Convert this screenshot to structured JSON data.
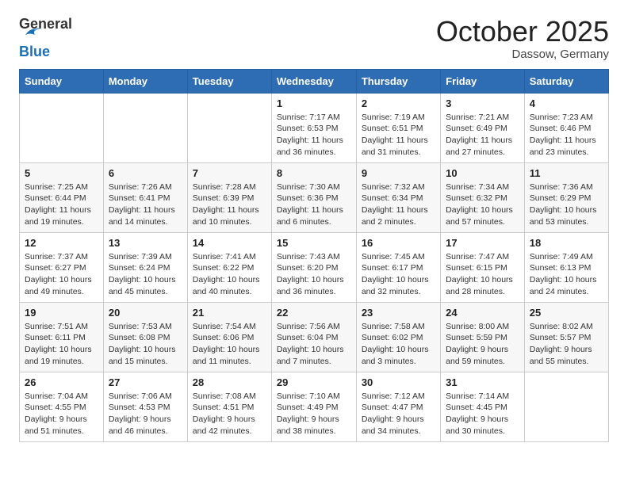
{
  "logo": {
    "general": "General",
    "blue": "Blue"
  },
  "title": {
    "month_year": "October 2025",
    "location": "Dassow, Germany"
  },
  "headers": [
    "Sunday",
    "Monday",
    "Tuesday",
    "Wednesday",
    "Thursday",
    "Friday",
    "Saturday"
  ],
  "weeks": [
    [
      {
        "day": "",
        "info": ""
      },
      {
        "day": "",
        "info": ""
      },
      {
        "day": "",
        "info": ""
      },
      {
        "day": "1",
        "info": "Sunrise: 7:17 AM\nSunset: 6:53 PM\nDaylight: 11 hours and 36 minutes."
      },
      {
        "day": "2",
        "info": "Sunrise: 7:19 AM\nSunset: 6:51 PM\nDaylight: 11 hours and 31 minutes."
      },
      {
        "day": "3",
        "info": "Sunrise: 7:21 AM\nSunset: 6:49 PM\nDaylight: 11 hours and 27 minutes."
      },
      {
        "day": "4",
        "info": "Sunrise: 7:23 AM\nSunset: 6:46 PM\nDaylight: 11 hours and 23 minutes."
      }
    ],
    [
      {
        "day": "5",
        "info": "Sunrise: 7:25 AM\nSunset: 6:44 PM\nDaylight: 11 hours and 19 minutes."
      },
      {
        "day": "6",
        "info": "Sunrise: 7:26 AM\nSunset: 6:41 PM\nDaylight: 11 hours and 14 minutes."
      },
      {
        "day": "7",
        "info": "Sunrise: 7:28 AM\nSunset: 6:39 PM\nDaylight: 11 hours and 10 minutes."
      },
      {
        "day": "8",
        "info": "Sunrise: 7:30 AM\nSunset: 6:36 PM\nDaylight: 11 hours and 6 minutes."
      },
      {
        "day": "9",
        "info": "Sunrise: 7:32 AM\nSunset: 6:34 PM\nDaylight: 11 hours and 2 minutes."
      },
      {
        "day": "10",
        "info": "Sunrise: 7:34 AM\nSunset: 6:32 PM\nDaylight: 10 hours and 57 minutes."
      },
      {
        "day": "11",
        "info": "Sunrise: 7:36 AM\nSunset: 6:29 PM\nDaylight: 10 hours and 53 minutes."
      }
    ],
    [
      {
        "day": "12",
        "info": "Sunrise: 7:37 AM\nSunset: 6:27 PM\nDaylight: 10 hours and 49 minutes."
      },
      {
        "day": "13",
        "info": "Sunrise: 7:39 AM\nSunset: 6:24 PM\nDaylight: 10 hours and 45 minutes."
      },
      {
        "day": "14",
        "info": "Sunrise: 7:41 AM\nSunset: 6:22 PM\nDaylight: 10 hours and 40 minutes."
      },
      {
        "day": "15",
        "info": "Sunrise: 7:43 AM\nSunset: 6:20 PM\nDaylight: 10 hours and 36 minutes."
      },
      {
        "day": "16",
        "info": "Sunrise: 7:45 AM\nSunset: 6:17 PM\nDaylight: 10 hours and 32 minutes."
      },
      {
        "day": "17",
        "info": "Sunrise: 7:47 AM\nSunset: 6:15 PM\nDaylight: 10 hours and 28 minutes."
      },
      {
        "day": "18",
        "info": "Sunrise: 7:49 AM\nSunset: 6:13 PM\nDaylight: 10 hours and 24 minutes."
      }
    ],
    [
      {
        "day": "19",
        "info": "Sunrise: 7:51 AM\nSunset: 6:11 PM\nDaylight: 10 hours and 19 minutes."
      },
      {
        "day": "20",
        "info": "Sunrise: 7:53 AM\nSunset: 6:08 PM\nDaylight: 10 hours and 15 minutes."
      },
      {
        "day": "21",
        "info": "Sunrise: 7:54 AM\nSunset: 6:06 PM\nDaylight: 10 hours and 11 minutes."
      },
      {
        "day": "22",
        "info": "Sunrise: 7:56 AM\nSunset: 6:04 PM\nDaylight: 10 hours and 7 minutes."
      },
      {
        "day": "23",
        "info": "Sunrise: 7:58 AM\nSunset: 6:02 PM\nDaylight: 10 hours and 3 minutes."
      },
      {
        "day": "24",
        "info": "Sunrise: 8:00 AM\nSunset: 5:59 PM\nDaylight: 9 hours and 59 minutes."
      },
      {
        "day": "25",
        "info": "Sunrise: 8:02 AM\nSunset: 5:57 PM\nDaylight: 9 hours and 55 minutes."
      }
    ],
    [
      {
        "day": "26",
        "info": "Sunrise: 7:04 AM\nSunset: 4:55 PM\nDaylight: 9 hours and 51 minutes."
      },
      {
        "day": "27",
        "info": "Sunrise: 7:06 AM\nSunset: 4:53 PM\nDaylight: 9 hours and 46 minutes."
      },
      {
        "day": "28",
        "info": "Sunrise: 7:08 AM\nSunset: 4:51 PM\nDaylight: 9 hours and 42 minutes."
      },
      {
        "day": "29",
        "info": "Sunrise: 7:10 AM\nSunset: 4:49 PM\nDaylight: 9 hours and 38 minutes."
      },
      {
        "day": "30",
        "info": "Sunrise: 7:12 AM\nSunset: 4:47 PM\nDaylight: 9 hours and 34 minutes."
      },
      {
        "day": "31",
        "info": "Sunrise: 7:14 AM\nSunset: 4:45 PM\nDaylight: 9 hours and 30 minutes."
      },
      {
        "day": "",
        "info": ""
      }
    ]
  ]
}
